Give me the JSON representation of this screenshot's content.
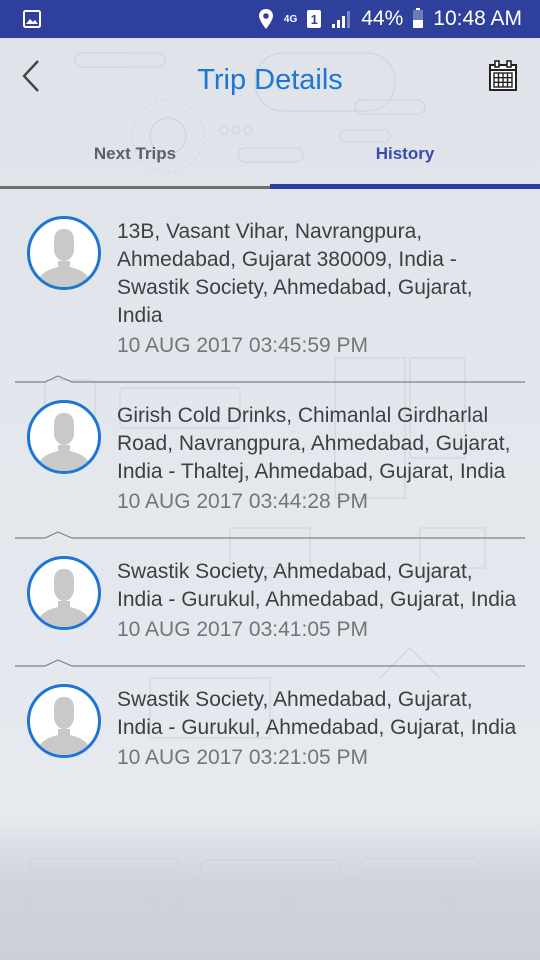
{
  "statusbar": {
    "left_icon": "image-notification-icon",
    "network_label": "4G",
    "sim_label": "1",
    "battery_percent_label": "44%",
    "battery_level": 0.44,
    "time": "10:48 AM"
  },
  "toolbar": {
    "title": "Trip Details",
    "back_icon": "chevron-left-icon",
    "calendar_icon": "calendar-icon"
  },
  "tabs": [
    {
      "label": "Next Trips",
      "selected": false
    },
    {
      "label": "History",
      "selected": true
    }
  ],
  "colors": {
    "primary": "#2f3f9c",
    "accent_blue": "#1d76d2",
    "tab_selected": "#3a4aa8",
    "text_primary": "#3d3f41",
    "text_secondary": "#737678"
  },
  "trips": [
    {
      "address": "13B, Vasant Vihar, Navrangpura, Ahmedabad, Gujarat 380009, India - Swastik Society, Ahmedabad, Gujarat, India",
      "timestamp": "10 AUG 2017 03:45:59 PM"
    },
    {
      "address": "Girish Cold Drinks, Chimanlal Girdharlal Road, Navrangpura, Ahmedabad, Gujarat, India - Thaltej, Ahmedabad, Gujarat, India",
      "timestamp": "10 AUG 2017 03:44:28 PM"
    },
    {
      "address": "Swastik Society, Ahmedabad, Gujarat, India - Gurukul, Ahmedabad, Gujarat, India",
      "timestamp": "10 AUG 2017 03:41:05 PM"
    },
    {
      "address": "Swastik Society, Ahmedabad, Gujarat, India - Gurukul, Ahmedabad, Gujarat, India",
      "timestamp": "10 AUG 2017 03:21:05 PM"
    }
  ]
}
